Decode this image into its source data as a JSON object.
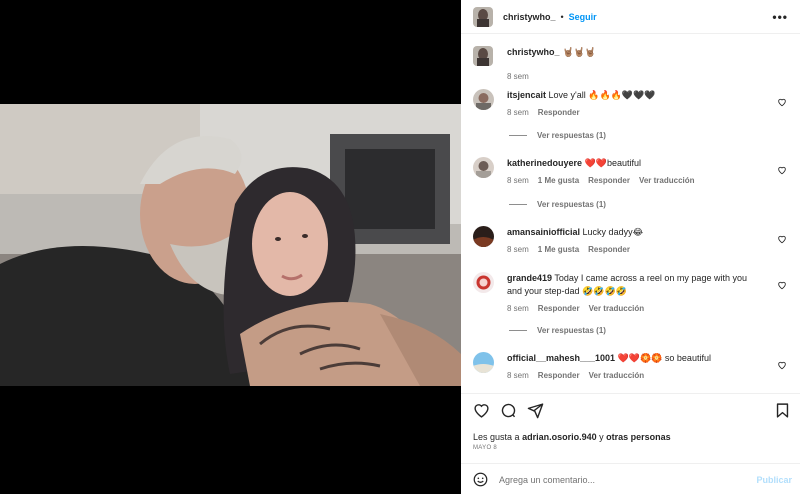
{
  "post": {
    "author": "christywho_",
    "follow_label": "Seguir",
    "separator": "•",
    "more_label": "•••",
    "caption_text": "🤘🏽🤘🏽🤘🏽",
    "caption_time": "8 sem"
  },
  "comments": [
    {
      "user": "itsjencait",
      "text": "Love y'all 🔥🔥🔥🖤🖤🖤",
      "time": "8 sem",
      "likes": "",
      "reply": "Responder",
      "translate": "",
      "view_replies": "Ver respuestas (1)"
    },
    {
      "user": "katherinedouyere",
      "text": "❤️❤️beautiful",
      "time": "8 sem",
      "likes": "1 Me gusta",
      "reply": "Responder",
      "translate": "Ver traducción",
      "view_replies": "Ver respuestas (1)"
    },
    {
      "user": "amansainiofficial",
      "text": "Lucky dadyy😂",
      "time": "8 sem",
      "likes": "1 Me gusta",
      "reply": "Responder",
      "translate": "",
      "view_replies": ""
    },
    {
      "user": "grande419",
      "text": "Today I came across a reel on my page with you and your step-dad 🤣🤣🤣🤣",
      "time": "8 sem",
      "likes": "",
      "reply": "Responder",
      "translate": "Ver traducción",
      "view_replies": "Ver respuestas (1)"
    },
    {
      "user": "official__mahesh___1001",
      "text": "❤️❤️🏵️🏵️ so beautiful",
      "time": "8 sem",
      "likes": "",
      "reply": "Responder",
      "translate": "Ver traducción",
      "view_replies": ""
    }
  ],
  "footer": {
    "likes_prefix": "Les gusta a",
    "likes_user": "adrian.osorio.940",
    "likes_joiner": "y",
    "likes_others": "otras personas",
    "date": "MAYO 8",
    "comment_placeholder": "Agrega un comentario...",
    "post_label": "Publicar"
  },
  "icons": {
    "like": "heart-icon",
    "comment": "comment-icon",
    "share": "send-icon",
    "save": "bookmark-icon",
    "emoji": "smiley-icon"
  },
  "colors": {
    "link": "#0095f6",
    "muted": "#737373",
    "publish_disabled": "#b2dffc"
  }
}
